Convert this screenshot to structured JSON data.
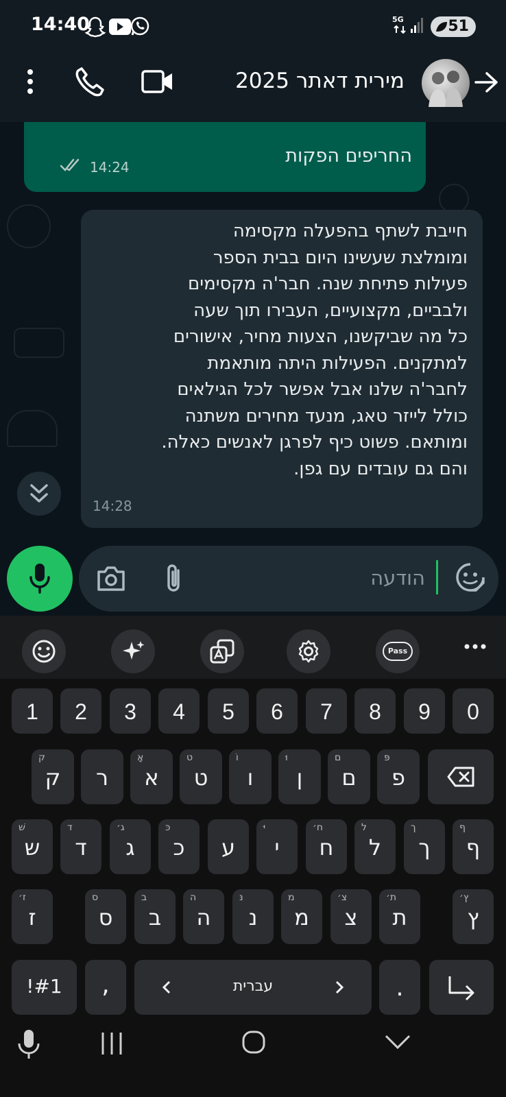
{
  "status_bar": {
    "time": "14:40",
    "network": "5G",
    "battery": "51"
  },
  "header": {
    "contact_name": "מירית דאתר 2025"
  },
  "messages": [
    {
      "direction": "outgoing",
      "text": "החריפים הפקות",
      "time": "14:24",
      "status": "read"
    },
    {
      "direction": "incoming",
      "lines": [
        "חייבת לשתף בהפעלה מקסימה",
        "ומומלצת שעשינו היום בבית הספר",
        "פעילות פתיחת שנה.  חבר'ה מקסימים",
        "ולבביים, מקצועיים, העבירו תוך שעה",
        "כל מה שביקשנו, הצעות מחיר, אישורים",
        "למתקנים.  הפעילות היתה מותאמת",
        "לחבר'ה שלנו אבל אפשר לכל הגילאים",
        "כולל לייזר טאג, מנעד מחירים משתנה",
        "ומותאם. פשוט כיף לפרגן לאנשים כאלה.",
        "והם גם עובדים עם גפן."
      ],
      "time": "14:28"
    }
  ],
  "composer": {
    "placeholder": "הודעה"
  },
  "keyboard": {
    "numbers": [
      "1",
      "2",
      "3",
      "4",
      "5",
      "6",
      "7",
      "8",
      "9",
      "0"
    ],
    "row1": [
      {
        "main": "ק",
        "sub": "ק"
      },
      {
        "main": "ר",
        "sub": ""
      },
      {
        "main": "א",
        "sub": "אָ"
      },
      {
        "main": "ט",
        "sub": "ט"
      },
      {
        "main": "ו",
        "sub": "וֹ"
      },
      {
        "main": "ן",
        "sub": "וּ"
      },
      {
        "main": "ם",
        "sub": "ם"
      },
      {
        "main": "פ",
        "sub": "פּ"
      }
    ],
    "row2": [
      {
        "main": "ש",
        "sub": "שׁ"
      },
      {
        "main": "ד",
        "sub": "ד"
      },
      {
        "main": "ג",
        "sub": "ג׳"
      },
      {
        "main": "כ",
        "sub": "כּ"
      },
      {
        "main": "ע",
        "sub": ""
      },
      {
        "main": "י",
        "sub": "יּ"
      },
      {
        "main": "ח",
        "sub": "ח׳"
      },
      {
        "main": "ל",
        "sub": "ל"
      },
      {
        "main": "ך",
        "sub": "ך"
      },
      {
        "main": "ף",
        "sub": "ף"
      }
    ],
    "row3": [
      {
        "main": "ז",
        "sub": "ז׳"
      },
      {
        "main": "ס",
        "sub": "ס"
      },
      {
        "main": "ב",
        "sub": "ב"
      },
      {
        "main": "ה",
        "sub": "ה"
      },
      {
        "main": "נ",
        "sub": "נּ"
      },
      {
        "main": "מ",
        "sub": "מ"
      },
      {
        "main": "צ",
        "sub": "צ׳"
      },
      {
        "main": "ת",
        "sub": "ת׳"
      },
      {
        "main": "ץ",
        "sub": "ץ׳"
      }
    ],
    "symbols_key": "!#1",
    "comma": ",",
    "space_label": "עברית",
    "period": ".",
    "toolbar_pass": "Pass"
  }
}
